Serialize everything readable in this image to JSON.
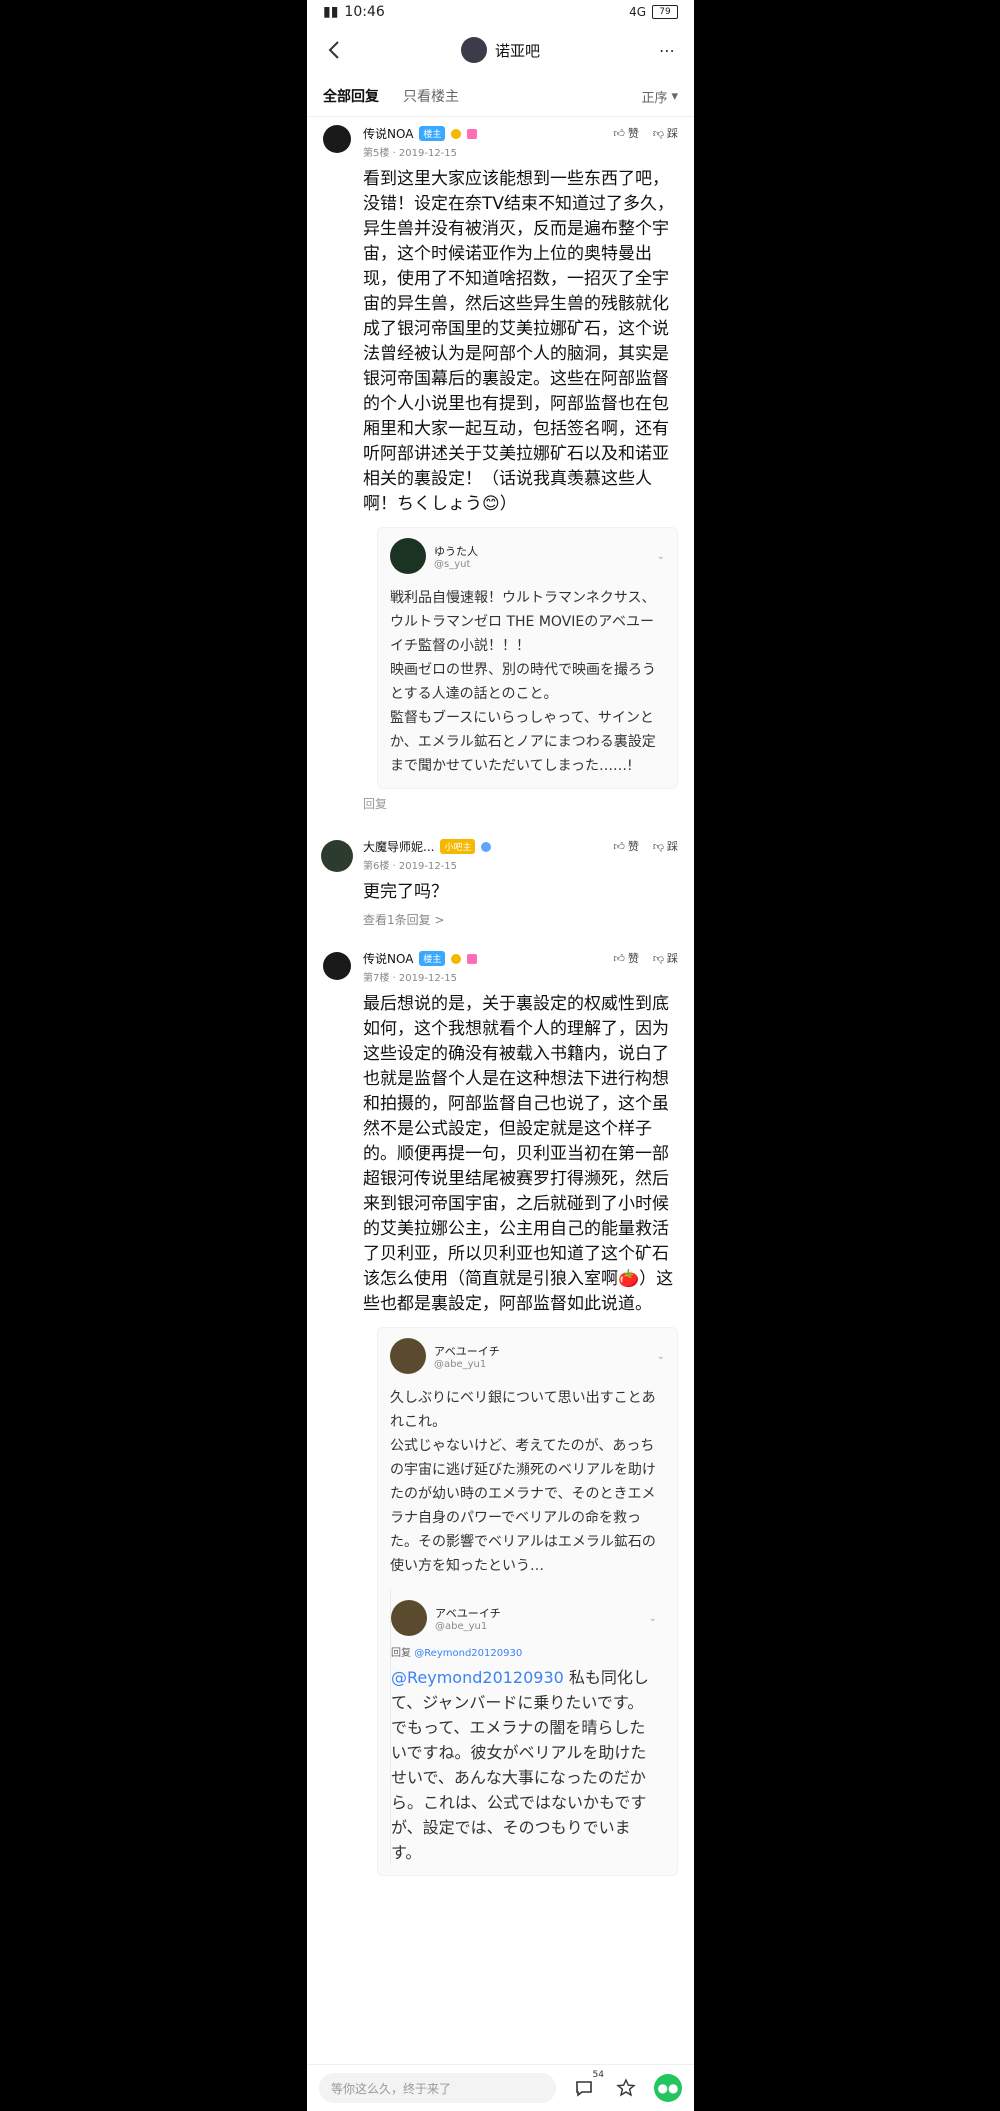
{
  "status": {
    "time": "10:46",
    "right": "4G",
    "battery": "79"
  },
  "header": {
    "title": "诺亚吧"
  },
  "tabs": {
    "all": "全部回复",
    "op": "只看楼主",
    "sort": "正序"
  },
  "actions": {
    "like": "赞",
    "dislike": "踩"
  },
  "posts": [
    {
      "name": "传说NOA",
      "badge": "楼主",
      "meta": "第5楼 · 2019-12-15",
      "text": "看到这里大家应该能想到一些东西了吧，没错！设定在奈TV结束不知道过了多久，异生兽并没有被消灭，反而是遍布整个宇宙，这个时候诺亚作为上位的奥特曼出现，使用了不知道啥招数，一招灭了全宇宙的异生兽，然后这些异生兽的残骸就化成了银河帝国里的艾美拉娜矿石，这个说法曾经被认为是阿部个人的脑洞，其实是银河帝国幕后的裏設定。这些在阿部监督的个人小说里也有提到，阿部监督也在包厢里和大家一起互动，包括签名啊，还有听阿部讲述关于艾美拉娜矿石以及和诺亚相关的裏設定！（话说我真羡慕这些人啊！ちくしょう😊）",
      "quote": {
        "name": "ゆうた人",
        "handle": "@s_yut",
        "text": "戦利品自慢速報！ウルトラマンネクサス、ウルトラマンゼロ THE MOVIEのアベユーイチ監督の小説！！！\n映画ゼロの世界、別の時代で映画を撮ろうとする人達の話とのこと。\n監督もブースにいらっしゃって、サインとか、エメラル鉱石とノアにまつわる裏設定まで聞かせていただいてしまった……!"
      },
      "reply": "回复"
    },
    {
      "name": "大魔导师妮...",
      "badge": "小吧主",
      "meta": "第6楼 · 2019-12-15",
      "text": "更完了吗？",
      "view_replies": "查看1条回复 >"
    },
    {
      "name": "传说NOA",
      "badge": "楼主",
      "meta": "第7楼 · 2019-12-15",
      "text": "最后想说的是，关于裏設定的权威性到底如何，这个我想就看个人的理解了，因为这些设定的确没有被载入书籍内，说白了也就是监督个人是在这种想法下进行构想和拍摄的，阿部监督自己也说了，这个虽然不是公式設定，但設定就是这个样子的。顺便再提一句，贝利亚当初在第一部超银河传说里结尾被赛罗打得濒死，然后来到银河帝国宇宙，之后就碰到了小时候的艾美拉娜公主，公主用自己的能量救活了贝利亚，所以贝利亚也知道了这个矿石该怎么使用（简直就是引狼入室啊🍅）这些也都是裏設定，阿部监督如此说道。",
      "quote": {
        "name": "アベユーイチ",
        "handle": "@abe_yu1",
        "text": "久しぶりにベリ銀について思い出すことあれこれ。\n公式じゃないけど、考えてたのが、あっちの宇宙に逃げ延びた瀕死のベリアルを助けたのが幼い時のエメラナで、そのときエメラナ自身のパワーでベリアルの命を救った。その影響でベリアルはエメラル鉱石の使い方を知ったという…",
        "nested": {
          "name": "アベユーイチ",
          "handle": "@abe_yu1",
          "reply_to_prefix": "回复 ",
          "reply_to": "@Reymond20120930",
          "mention": "@Reymond20120930",
          "text": " 私も同化して、ジャンバードに乗りたいです。でもって、エメラナの闇を晴らしたいですね。彼女がベリアルを助けたせいで、あんな大事になったのだから。これは、公式ではないかもですが、設定では、そのつもりでいます。"
        }
      }
    }
  ],
  "bottom": {
    "placeholder": "等你这么久，终于来了",
    "comment_count": "54"
  }
}
